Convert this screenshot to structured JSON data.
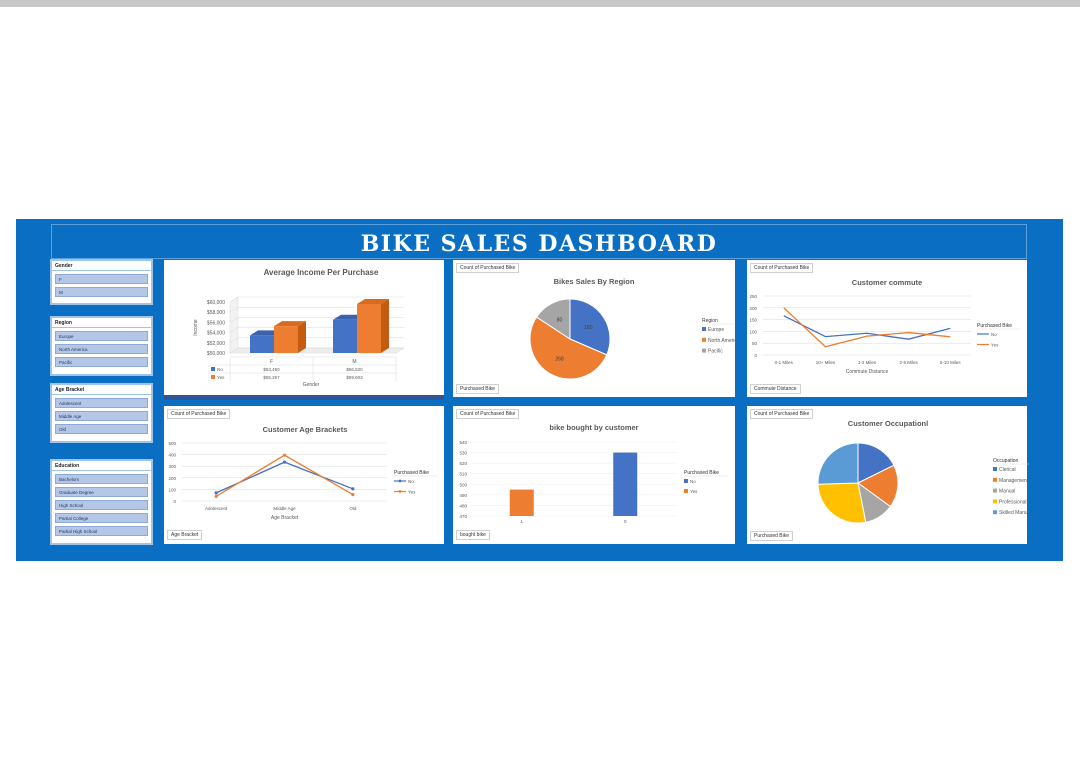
{
  "dashboard": {
    "title": "BIKE SALES DASHBOARD"
  },
  "slicers": [
    {
      "title": "Gender",
      "items": [
        "F",
        "M"
      ]
    },
    {
      "title": "Region",
      "items": [
        "Europe",
        "North America",
        "Pacific"
      ]
    },
    {
      "title": "Age Bracket",
      "items": [
        "Adolescent",
        "Middle Age",
        "Old"
      ]
    },
    {
      "title": "Education",
      "items": [
        "Bachelors",
        "Graduate Degree",
        "High School",
        "Partial College",
        "Partial High School"
      ]
    }
  ],
  "colors": {
    "blue": "#4472c4",
    "orange": "#ed7d31",
    "gray": "#a5a5a5",
    "yellow": "#ffc000",
    "lightblue": "#5b9bd5",
    "dashboard": "#0a6fc2"
  },
  "chart_data": [
    {
      "id": "income",
      "type": "bar",
      "title": "Average Income Per Purchase",
      "xlabel": "Gender",
      "ylabel": "Income",
      "categories": [
        "F",
        "M"
      ],
      "series": [
        {
          "name": "No",
          "values": [
            53450,
            56520
          ],
          "labels": [
            "$53,450",
            "$56,520"
          ]
        },
        {
          "name": "Yes",
          "values": [
            55267,
            59603
          ],
          "labels": [
            "$55,267",
            "$59,603"
          ]
        }
      ],
      "ylim": [
        50000,
        60000
      ],
      "yticks": [
        "$50,000",
        "$52,000",
        "$54,000",
        "$56,000",
        "$58,000",
        "$60,000"
      ],
      "data_table": true
    },
    {
      "id": "region",
      "type": "pie",
      "title": "Bikes Sales By Region",
      "field_button": "Count of Purchased Bike",
      "filter_button": "Purchased Bike",
      "legend_title": "Region",
      "categories": [
        "Europe",
        "North America",
        "Pacific"
      ],
      "values": [
        160,
        268,
        80
      ]
    },
    {
      "id": "commute",
      "type": "line",
      "title": "Customer commute",
      "field_button": "Count of Purchased Bike",
      "filter_button": "Commute Distance",
      "xlabel": "Commute Distance",
      "legend_title": "Purchased Bike",
      "categories": [
        "0-1 Miles",
        "10+ Miles",
        "1-2 Miles",
        "2-5 Miles",
        "5-10 Miles"
      ],
      "series": [
        {
          "name": "No",
          "values": [
            166,
            78,
            92,
            67,
            113
          ]
        },
        {
          "name": "Yes",
          "values": [
            200,
            35,
            80,
            95,
            77
          ]
        }
      ],
      "ylim": [
        0,
        250
      ],
      "yticks": [
        "0",
        "50",
        "100",
        "150",
        "200",
        "250"
      ]
    },
    {
      "id": "age",
      "type": "line",
      "title": "Customer Age Brackets",
      "field_button": "Count of Purchased Bike",
      "filter_button": "Age Bracket",
      "xlabel": "Age Bracket",
      "legend_title": "Purchased Bike",
      "categories": [
        "Adolescent",
        "Middle Age",
        "Old"
      ],
      "series": [
        {
          "name": "No",
          "values": [
            70,
            335,
            105
          ]
        },
        {
          "name": "Yes",
          "values": [
            40,
            395,
            55
          ]
        }
      ],
      "ylim": [
        0,
        500
      ],
      "yticks": [
        "0",
        "100",
        "200",
        "300",
        "400",
        "500"
      ]
    },
    {
      "id": "bought",
      "type": "bar",
      "title": "bike bought by customer",
      "field_button": "Count of Purchased Bike",
      "filter_button": "bought  bike",
      "legend_title": "Purchased Bike",
      "categories": [
        "1",
        "0"
      ],
      "series": [
        {
          "name": "No",
          "values": [
            null,
            530
          ]
        },
        {
          "name": "Yes",
          "values": [
            495,
            null
          ]
        }
      ],
      "ylim": [
        470,
        540
      ],
      "yticks": [
        "470",
        "480",
        "490",
        "500",
        "510",
        "520",
        "530",
        "540"
      ]
    },
    {
      "id": "occupation",
      "type": "pie",
      "title": "Customer Occupationl",
      "field_button": "Count of Purchased Bike",
      "filter_button": "Purchased Bike",
      "legend_title": "Occupation",
      "categories": [
        "Clerical",
        "Management",
        "Manual",
        "Professional",
        "Skilled Manual"
      ],
      "values": [
        177,
        173,
        119,
        276,
        255
      ]
    }
  ]
}
